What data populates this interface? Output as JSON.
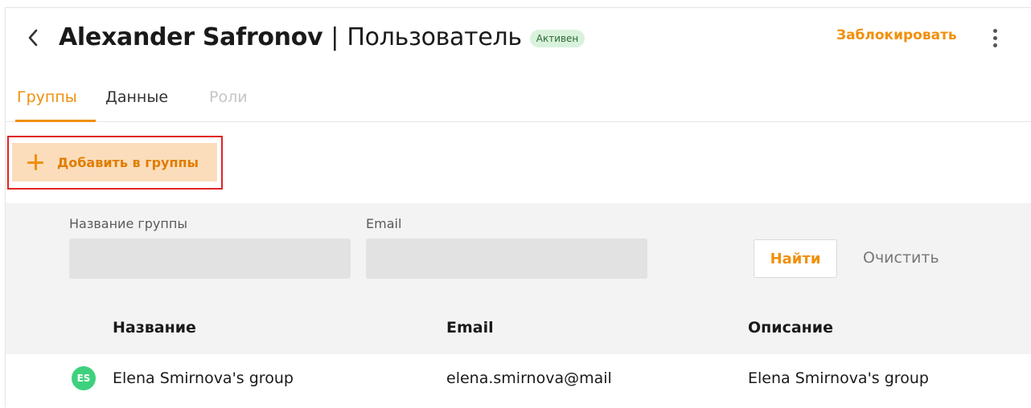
{
  "header": {
    "user_name": "Alexander Safronov",
    "separator": "|",
    "page_kind": "Пользователь",
    "status_badge": "Активен",
    "block_action": "Заблокировать"
  },
  "tabs": [
    {
      "label": "Группы",
      "active": true
    },
    {
      "label": "Данные",
      "active": false
    },
    {
      "label": "Роли",
      "active": false,
      "disabled": true
    }
  ],
  "actions": {
    "add_to_groups": "Добавить в группы"
  },
  "filter": {
    "group_name_label": "Название группы",
    "group_name_value": "",
    "email_label": "Email",
    "email_value": "",
    "find_label": "Найти",
    "clear_label": "Очистить"
  },
  "table": {
    "columns": [
      "Название",
      "Email",
      "Описание"
    ],
    "rows": [
      {
        "avatar_initials": "ES",
        "name": "Elena Smirnova's group",
        "email": "elena.smirnova@mail",
        "description": "Elena Smirnova's group"
      }
    ]
  },
  "colors": {
    "accent": "#f0900c",
    "badge_bg": "#d9f2dc",
    "avatar_bg": "#3ed17d",
    "highlight_outline": "#e02424"
  }
}
